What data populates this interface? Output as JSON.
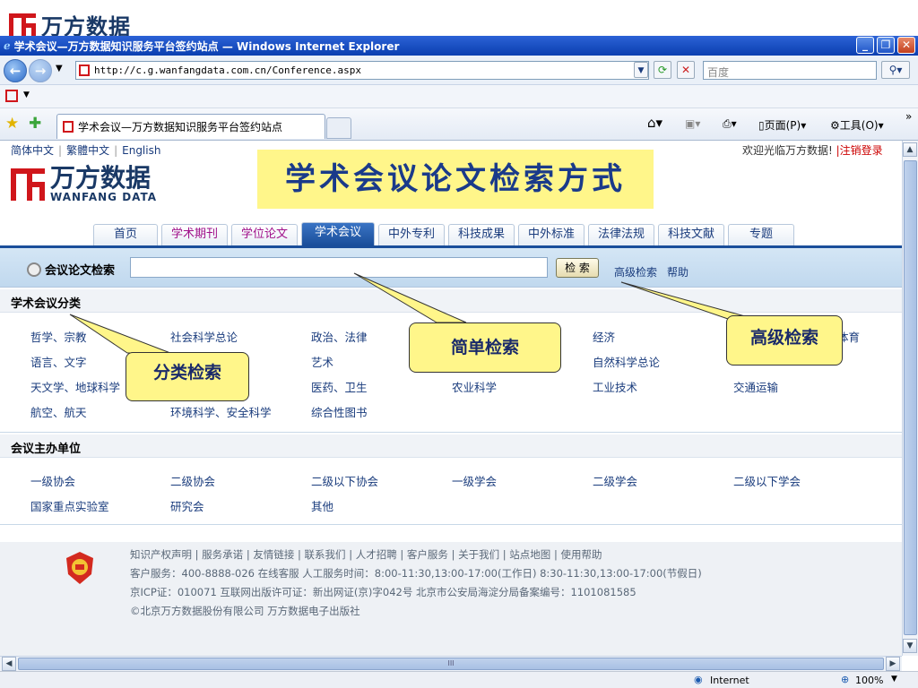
{
  "slide": {
    "logo_text": "万方数据",
    "banner_title": "学术会议论文检索方式"
  },
  "browser": {
    "title": "学术会议—万方数据知识服务平台签约站点 — Windows Internet Explorer",
    "url": "http://c.g.wanfangdata.com.cn/Conference.aspx",
    "search_placeholder": "百度",
    "tab_title": "学术会议—万方数据知识服务平台签约站点",
    "page_menu": "页面(P)",
    "tools_menu": "工具(O)",
    "status_zone": "Internet",
    "zoom": "100%",
    "scroll_mark": "III"
  },
  "lang_links": [
    "简体中文",
    "繁體中文",
    "English"
  ],
  "welcome": "欢迎光临万方数据!",
  "logout": "|注销登录",
  "site_logo": {
    "cn": "万方数据",
    "en": "WANFANG DATA"
  },
  "nav_tabs": [
    {
      "label": "首页"
    },
    {
      "label": "学术期刊"
    },
    {
      "label": "学位论文"
    },
    {
      "label": "学术会议"
    },
    {
      "label": "中外专利"
    },
    {
      "label": "科技成果"
    },
    {
      "label": "中外标准"
    },
    {
      "label": "法律法规"
    },
    {
      "label": "科技文献"
    },
    {
      "label": "专题"
    }
  ],
  "search": {
    "label": "会议论文检索",
    "button": "检 索",
    "advanced": "高级检索",
    "help": "帮助"
  },
  "categories_section": {
    "title": "学术会议分类",
    "items": [
      "哲学、宗教",
      "社会科学总论",
      "政治、法律",
      "经济",
      "体育",
      "语言、文字",
      "艺术",
      "自然科学总论",
      "天文学、地球科学",
      "医药、卫生",
      "农业科学",
      "工业技术",
      "交通运输",
      "航空、航天",
      "环境科学、安全科学",
      "综合性图书"
    ]
  },
  "organizers_section": {
    "title": "会议主办单位",
    "items": [
      "一级协会",
      "二级协会",
      "二级以下协会",
      "一级学会",
      "二级学会",
      "二级以下学会",
      "国家重点实验室",
      "研究会",
      "其他"
    ]
  },
  "footer": {
    "links": "知识产权声明 | 服务承诺 | 友情链接 | 联系我们 | 人才招聘 | 客户服务 | 关于我们 | 站点地图 | 使用帮助",
    "service": "客户服务：400-8888-026 在线客服  人工服务时间：8:00-11:30,13:00-17:00(工作日) 8:30-11:30,13:00-17:00(节假日)",
    "icp": "京ICP证：010071 互联网出版许可证：新出网证(京)字042号 北京市公安局海淀分局备案编号：1101081585",
    "copyright": "©北京万方数据股份有限公司 万方数据电子出版社"
  },
  "callouts": {
    "simple": "简单检索",
    "advanced": "高级检索",
    "category": "分类检索"
  }
}
